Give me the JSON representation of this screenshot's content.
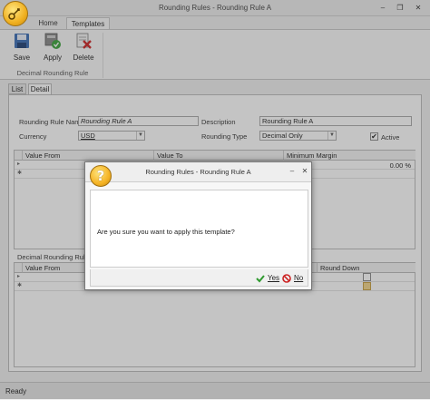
{
  "window": {
    "title": "Rounding Rules - Rounding Rule A",
    "minimize": "–",
    "restore": "❐",
    "close": "✕"
  },
  "ribbon": {
    "tabs": [
      "Home",
      "Templates"
    ],
    "buttons": {
      "save": "Save",
      "apply": "Apply",
      "delete": "Delete"
    },
    "group_label": "Decimal Rounding Rule"
  },
  "content_tabs": [
    "List",
    "Detail"
  ],
  "form": {
    "rule_name_label": "Rounding Rule Name",
    "rule_name_value": "Rounding Rule A",
    "description_label": "Description",
    "description_value": "Rounding Rule A",
    "currency_label": "Currency",
    "currency_value": "USD",
    "rounding_type_label": "Rounding Type",
    "rounding_type_value": "Decimal Only",
    "active_label": "Active",
    "active_checked": true
  },
  "grid1": {
    "columns": [
      "Value From",
      "Value To",
      "Minimum Margin"
    ],
    "row1_margin": "0.00 %"
  },
  "grid2": {
    "section_title": "Decimal Rounding Rule -",
    "columns": [
      "Value From",
      "Round Down"
    ]
  },
  "status": "Ready",
  "dialog": {
    "title": "Rounding Rules - Rounding Rule A",
    "icon": "?",
    "minimize": "–",
    "close": "✕",
    "message": "Are you sure you want to apply this template?",
    "yes_label": "Yes",
    "no_label": "No"
  }
}
